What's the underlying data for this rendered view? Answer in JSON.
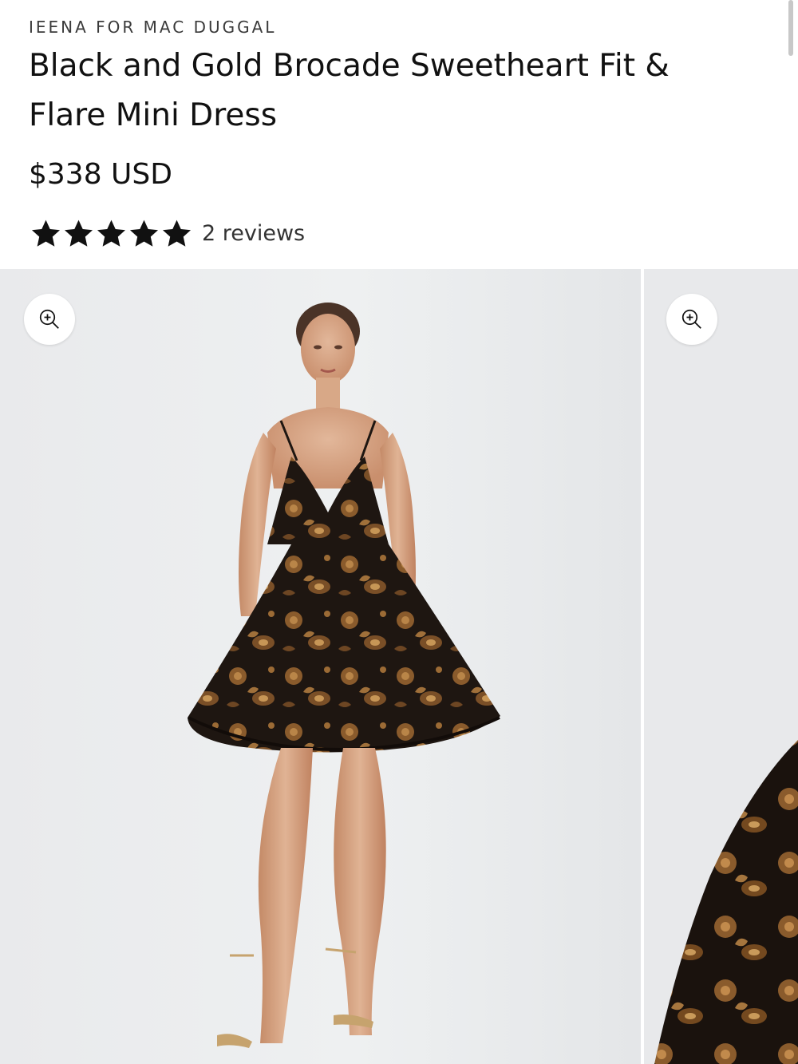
{
  "product": {
    "brand": "IEENA FOR MAC DUGGAL",
    "title": "Black and Gold Brocade Sweetheart Fit & Flare Mini Dress",
    "price": "$338 USD",
    "rating": {
      "stars": 5,
      "max": 5,
      "reviews_label": "2 reviews"
    }
  },
  "gallery": {
    "slides": [
      {
        "zoom_icon": "zoom-in-icon"
      },
      {
        "zoom_icon": "zoom-in-icon"
      }
    ]
  },
  "colors": {
    "text": "#111111",
    "brand_text": "#3a3a3a",
    "star": "#111111",
    "background": "#ffffff",
    "photo_bg": "#eceeef",
    "dress_black": "#1e1611",
    "dress_gold": "#9a6a34"
  }
}
